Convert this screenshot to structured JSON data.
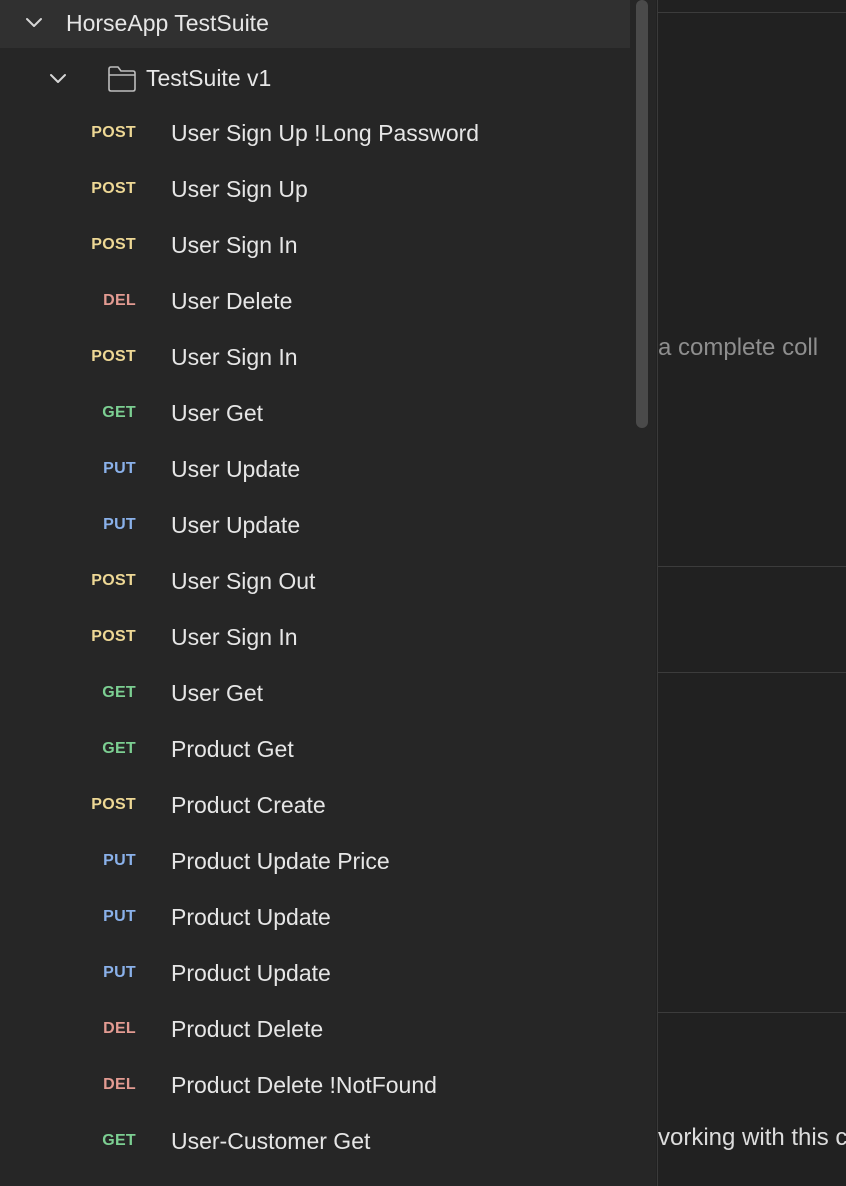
{
  "sidebar": {
    "collection": {
      "title": "HorseApp TestSuite",
      "expanded": true
    },
    "folder": {
      "title": "TestSuite v1",
      "expanded": true
    },
    "requests": [
      {
        "method": "POST",
        "name": "User Sign Up !Long Password"
      },
      {
        "method": "POST",
        "name": "User Sign Up"
      },
      {
        "method": "POST",
        "name": "User Sign In"
      },
      {
        "method": "DEL",
        "name": "User Delete"
      },
      {
        "method": "POST",
        "name": "User Sign In"
      },
      {
        "method": "GET",
        "name": "User Get"
      },
      {
        "method": "PUT",
        "name": "User Update"
      },
      {
        "method": "PUT",
        "name": "User Update"
      },
      {
        "method": "POST",
        "name": "User Sign Out"
      },
      {
        "method": "POST",
        "name": "User Sign In"
      },
      {
        "method": "GET",
        "name": "User Get"
      },
      {
        "method": "GET",
        "name": "Product Get"
      },
      {
        "method": "POST",
        "name": "Product Create"
      },
      {
        "method": "PUT",
        "name": "Product Update Price"
      },
      {
        "method": "PUT",
        "name": "Product Update"
      },
      {
        "method": "PUT",
        "name": "Product Update"
      },
      {
        "method": "DEL",
        "name": "Product Delete"
      },
      {
        "method": "DEL",
        "name": "Product Delete !NotFound"
      },
      {
        "method": "GET",
        "name": "User-Customer Get"
      }
    ]
  },
  "right_pane": {
    "text_1": "a complete coll",
    "text_2": "vorking with this c"
  },
  "colors": {
    "POST": "#eed895",
    "GET": "#7ccf92",
    "PUT": "#8ab1ea",
    "DEL": "#e39b92",
    "sidebar_bg": "#262626",
    "pane_bg": "#212121"
  }
}
